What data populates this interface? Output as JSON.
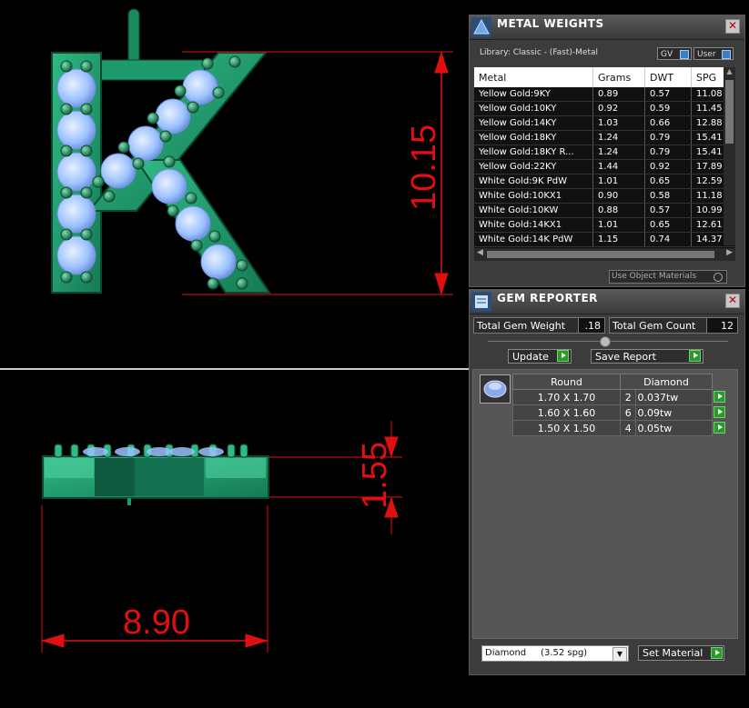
{
  "viewport": {
    "dim_height_top": "10.15",
    "dim_height_bottom": "1.55",
    "dim_width": "8.90",
    "colors": {
      "metal": "#1e9a6e",
      "gem": "#9cc2ff",
      "dimension": "#e01010"
    }
  },
  "metal_weights": {
    "title": "METAL WEIGHTS",
    "library_label": "Library: Classic - (Fast)-Metal",
    "toggle_gv": "GV",
    "toggle_user": "User",
    "columns": [
      "Metal",
      "Grams",
      "DWT",
      "SPG"
    ],
    "rows": [
      [
        "Yellow Gold:9KY",
        "0.89",
        "0.57",
        "11.08"
      ],
      [
        "Yellow Gold:10KY",
        "0.92",
        "0.59",
        "11.45"
      ],
      [
        "Yellow Gold:14KY",
        "1.03",
        "0.66",
        "12.88"
      ],
      [
        "Yellow Gold:18KY",
        "1.24",
        "0.79",
        "15.41"
      ],
      [
        "Yellow Gold:18KY R...",
        "1.24",
        "0.79",
        "15.41"
      ],
      [
        "Yellow Gold:22KY",
        "1.44",
        "0.92",
        "17.89"
      ],
      [
        "White Gold:9K PdW",
        "1.01",
        "0.65",
        "12.59"
      ],
      [
        "White Gold:10KX1",
        "0.90",
        "0.58",
        "11.18"
      ],
      [
        "White Gold:10KW",
        "0.88",
        "0.57",
        "10.99"
      ],
      [
        "White Gold:14KX1",
        "1.01",
        "0.65",
        "12.61"
      ],
      [
        "White Gold:14K PdW",
        "1.15",
        "0.74",
        "14.37"
      ]
    ],
    "use_object_materials": "Use Object Materials"
  },
  "gem_reporter": {
    "title": "GEM REPORTER",
    "total_weight_label": "Total Gem Weight",
    "total_weight_value": ".18",
    "total_count_label": "Total Gem Count",
    "total_count_value": "12",
    "update_label": "Update",
    "save_report_label": "Save Report",
    "table_headers": [
      "Round",
      "Diamond"
    ],
    "rows": [
      {
        "size": "1.70 X 1.70",
        "count": "2",
        "weight": "0.037tw"
      },
      {
        "size": "1.60 X 1.60",
        "count": "6",
        "weight": "0.09tw"
      },
      {
        "size": "1.50 X 1.50",
        "count": "4",
        "weight": "0.05tw"
      }
    ],
    "material_select": "Diamond     (3.52 spg)",
    "set_material_label": "Set Material"
  }
}
